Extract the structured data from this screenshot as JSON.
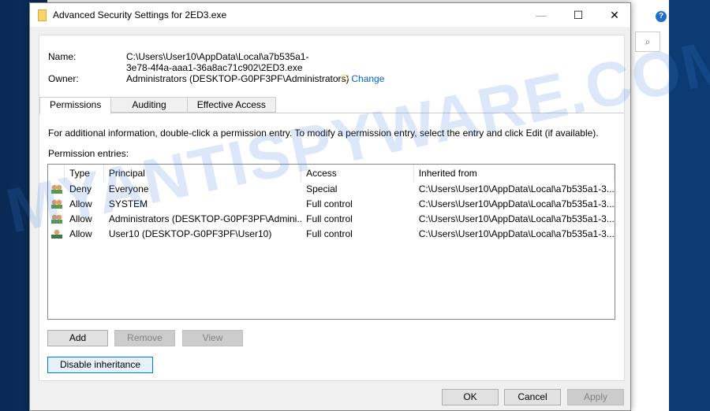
{
  "window": {
    "title": "Advanced Security Settings for 2ED3.exe",
    "minimize": "—",
    "maximize": "☐",
    "close": "✕"
  },
  "name": {
    "label": "Name:",
    "value": "C:\\Users\\User10\\AppData\\Local\\a7b535a1-3e78-4f4a-aaa1-36a8ac71c902\\2ED3.exe"
  },
  "owner": {
    "label": "Owner:",
    "value": "Administrators (DESKTOP-G0PF3PF\\Administrators)",
    "change": "Change"
  },
  "tabs": [
    "Permissions",
    "Auditing",
    "Effective Access"
  ],
  "info": "For additional information, double-click a permission entry. To modify a permission entry, select the entry and click Edit (if available).",
  "entries_label": "Permission entries:",
  "columns": [
    "Type",
    "Principal",
    "Access",
    "Inherited from"
  ],
  "rows": [
    {
      "type": "Deny",
      "principal": "Everyone",
      "access": "Special",
      "inherited": "C:\\Users\\User10\\AppData\\Local\\a7b535a1-3..."
    },
    {
      "type": "Allow",
      "principal": "SYSTEM",
      "access": "Full control",
      "inherited": "C:\\Users\\User10\\AppData\\Local\\a7b535a1-3..."
    },
    {
      "type": "Allow",
      "principal": "Administrators (DESKTOP-G0PF3PF\\Admini...",
      "access": "Full control",
      "inherited": "C:\\Users\\User10\\AppData\\Local\\a7b535a1-3..."
    },
    {
      "type": "Allow",
      "principal": "User10 (DESKTOP-G0PF3PF\\User10)",
      "access": "Full control",
      "inherited": "C:\\Users\\User10\\AppData\\Local\\a7b535a1-3..."
    }
  ],
  "buttons": {
    "add": "Add",
    "remove": "Remove",
    "view": "View",
    "disable": "Disable inheritance",
    "ok": "OK",
    "cancel": "Cancel",
    "apply": "Apply"
  },
  "watermark": "MYANTISPYWARE.COM"
}
